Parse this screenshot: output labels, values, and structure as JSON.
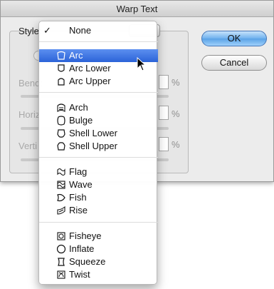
{
  "dialog": {
    "title": "Warp Text",
    "style_label": "Style:",
    "labels": {
      "bend": "Bend:",
      "horizontal": "Horiz",
      "vertical": "Verti"
    },
    "percent_sign": "%",
    "ok_label": "OK",
    "cancel_label": "Cancel"
  },
  "menu": {
    "none": {
      "label": "None",
      "checked": true
    },
    "groups": [
      [
        {
          "label": "Arc",
          "icon": "arc-icon",
          "selected": true
        },
        {
          "label": "Arc Lower",
          "icon": "arc-lower-icon"
        },
        {
          "label": "Arc Upper",
          "icon": "arc-upper-icon"
        }
      ],
      [
        {
          "label": "Arch",
          "icon": "arch-icon"
        },
        {
          "label": "Bulge",
          "icon": "bulge-icon"
        },
        {
          "label": "Shell Lower",
          "icon": "shell-lower-icon"
        },
        {
          "label": "Shell Upper",
          "icon": "shell-upper-icon"
        }
      ],
      [
        {
          "label": "Flag",
          "icon": "flag-icon"
        },
        {
          "label": "Wave",
          "icon": "wave-icon"
        },
        {
          "label": "Fish",
          "icon": "fish-icon"
        },
        {
          "label": "Rise",
          "icon": "rise-icon"
        }
      ],
      [
        {
          "label": "Fisheye",
          "icon": "fisheye-icon"
        },
        {
          "label": "Inflate",
          "icon": "inflate-icon"
        },
        {
          "label": "Squeeze",
          "icon": "squeeze-icon"
        },
        {
          "label": "Twist",
          "icon": "twist-icon"
        }
      ]
    ]
  },
  "colors": {
    "selection": "#2b63d8",
    "default_button": "#5aa2e6"
  }
}
